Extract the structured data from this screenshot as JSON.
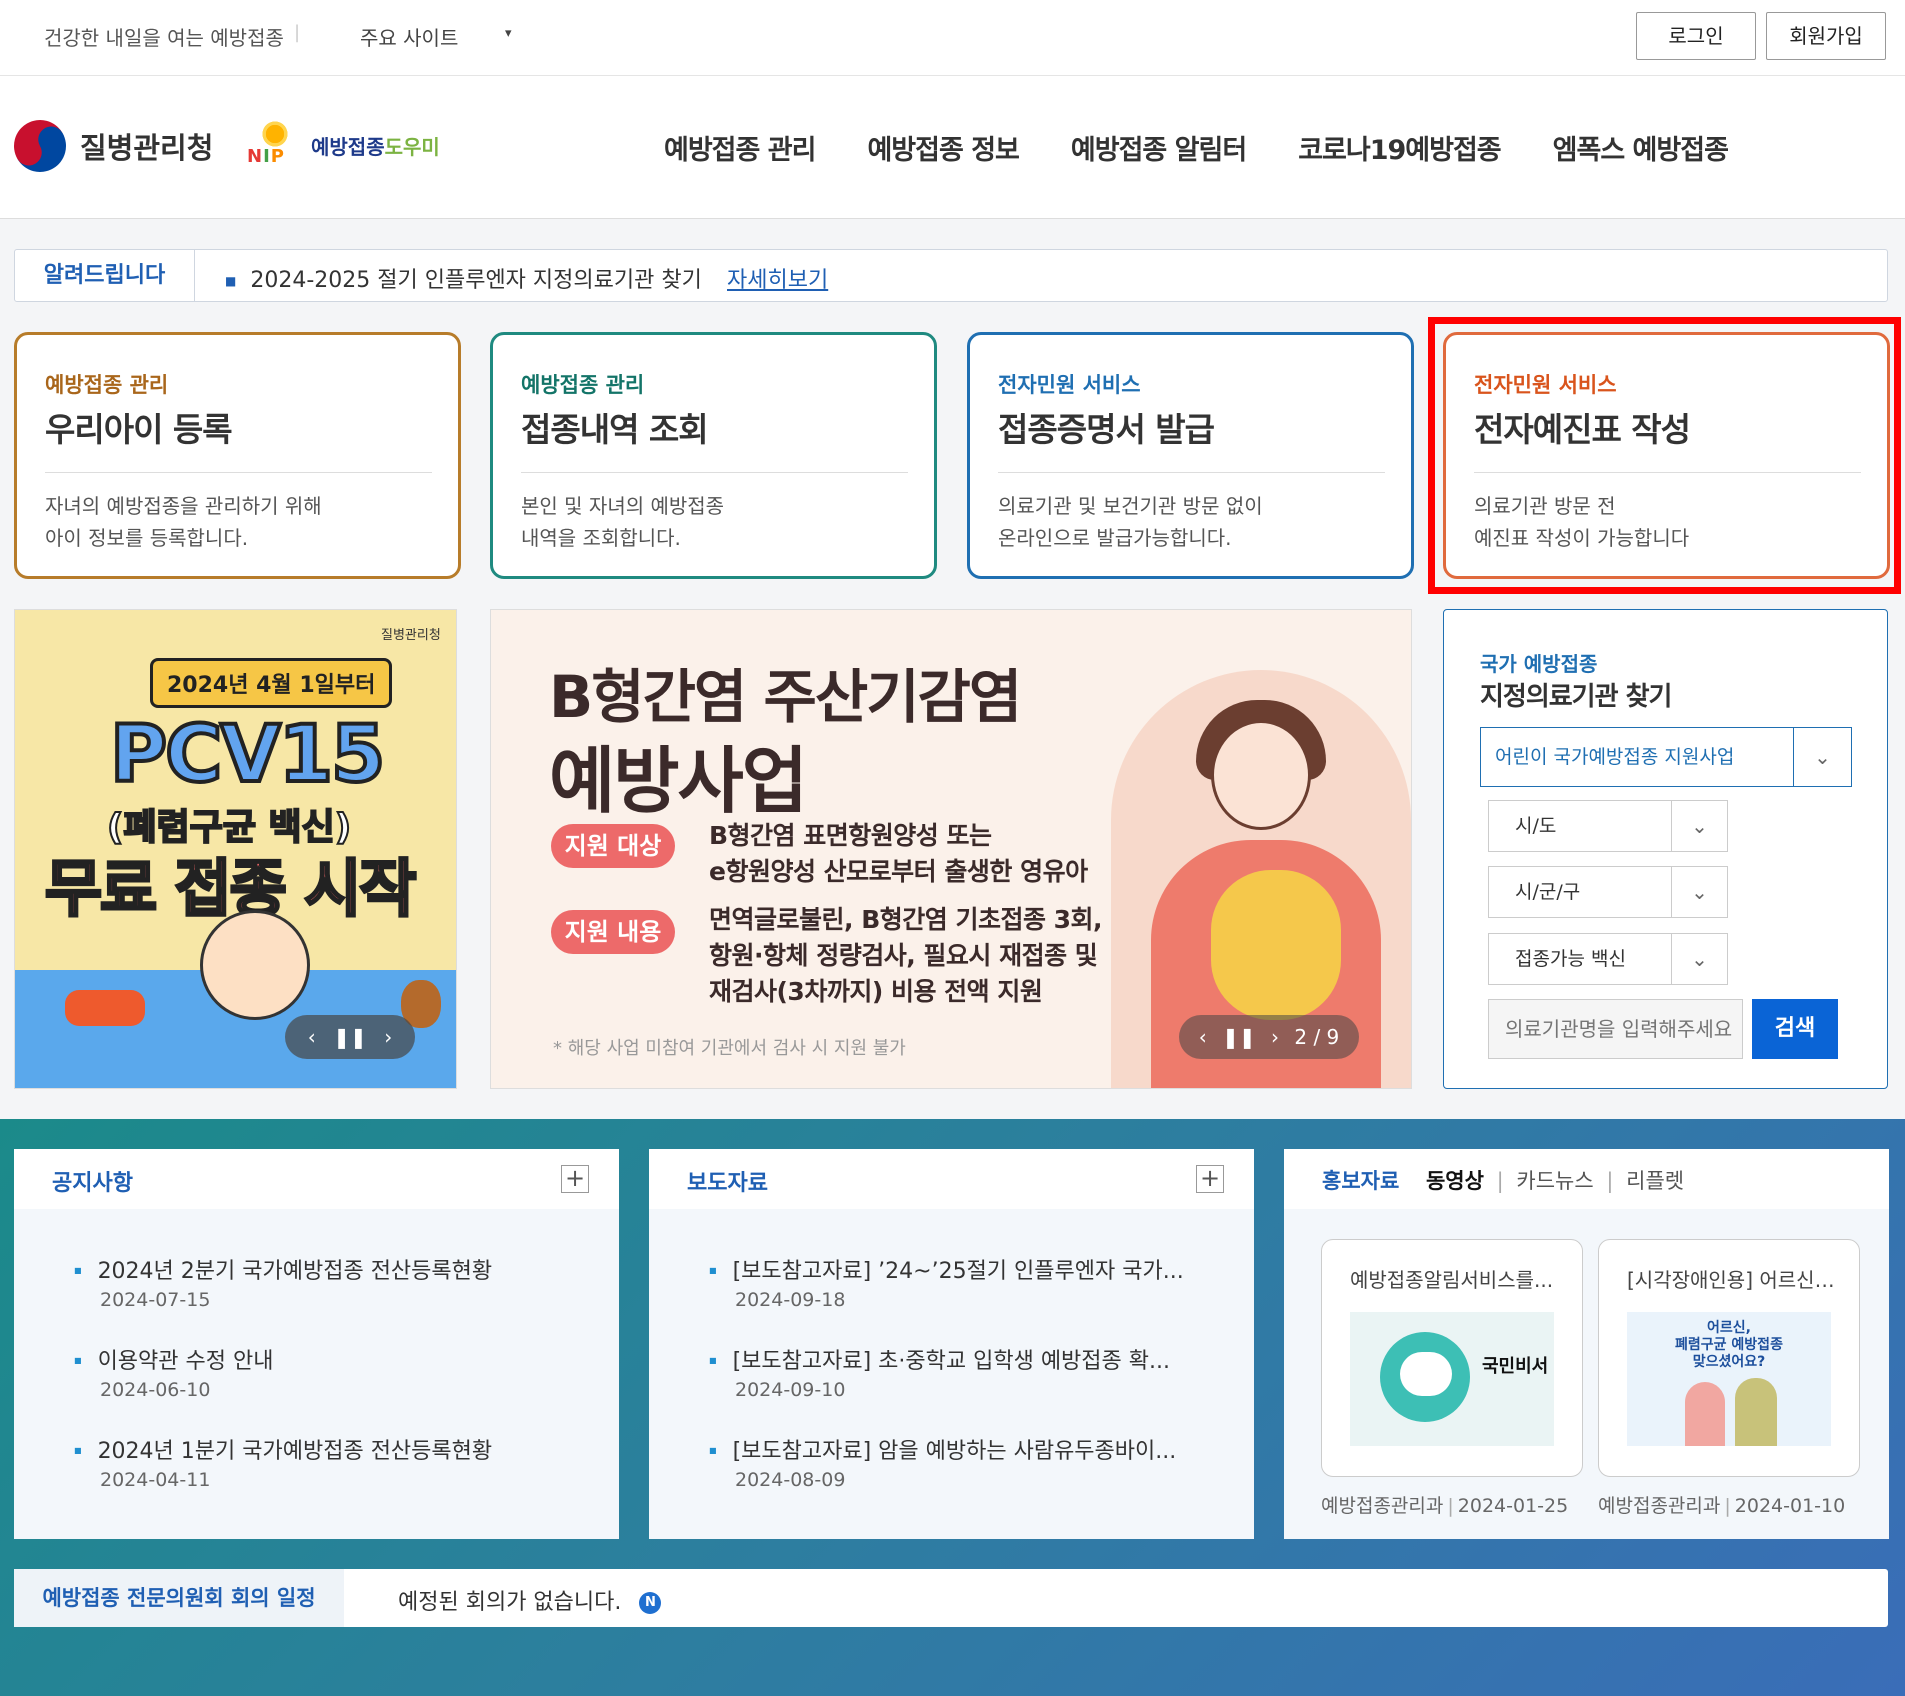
{
  "utility": {
    "slogan": "건강한 내일을 여는 예방접종",
    "separator": "|",
    "sites": "주요 사이트",
    "sites_caret": "▾",
    "login": "로그인",
    "join": "회원가입"
  },
  "header": {
    "agency_name": "질병관리청",
    "nip_letters": [
      "N",
      "I",
      "P"
    ],
    "nip_text_a": "예방접종",
    "nip_text_b": "도우미",
    "nav": [
      "예방접종 관리",
      "예방접종 정보",
      "예방접종 알림터",
      "코로나19예방접종",
      "엠폭스 예방접종"
    ]
  },
  "notice": {
    "label": "알려드립니다",
    "item": "2024-2025 절기 인플루엔자 지정의료기관 찾기",
    "more": "자세히보기"
  },
  "services": [
    {
      "category": "예방접종 관리",
      "title": "우리아이 등록",
      "desc": "자녀의 예방접종을 관리하기 위해\n아이 정보를 등록합니다."
    },
    {
      "category": "예방접종 관리",
      "title": "접종내역 조회",
      "desc": "본인 및 자녀의 예방접종\n내역을 조회합니다."
    },
    {
      "category": "전자민원 서비스",
      "title": "접종증명서 발급",
      "desc": "의료기관 및 보건기관 방문 없이\n온라인으로 발급가능합니다."
    },
    {
      "category": "전자민원 서비스",
      "title": "전자예진표 작성",
      "desc": "의료기관 방문 전\n예진표 작성이 가능합니다"
    }
  ],
  "banner_left": {
    "agency": "질병관리청",
    "date": "2024년 4월 1일부터",
    "headline": "PCV15",
    "sub": "(폐렴구균 백신)",
    "main": "무료 접종 시작",
    "prev": "‹",
    "pause": "❚❚",
    "next": "›"
  },
  "banner_main": {
    "line1": "B형간염 주산기감염",
    "line2": "예방사업",
    "tag1": "지원 대상",
    "desc1": "B형간염 표면항원양성 또는\ne항원양성 산모로부터 출생한 영유아",
    "tag2": "지원 내용",
    "desc2": "면역글로불린, B형간염 기초접종 3회,\n항원·항체 정량검사, 필요시 재접종 및\n재검사(3차까지) 비용 전액 지원",
    "note": "* 해당 사업 미참여 기관에서 검사 시 지원 불가",
    "prev": "‹",
    "pause": "❚❚",
    "next": "›",
    "counter": "2 / 9"
  },
  "finder": {
    "category": "국가 예방접종",
    "title": "지정의료기관 찾기",
    "program": "어린이 국가예방접종 지원사업",
    "sido": "시/도",
    "sigungu": "시/군/구",
    "vaccine": "접종가능 백신",
    "input_placeholder": "의료기관명을 입력해주세요",
    "search": "검색",
    "chevron": "⌄"
  },
  "notices": {
    "title": "공지사항",
    "plus": "+",
    "items": [
      {
        "title": "2024년 2분기 국가예방접종 전산등록현황",
        "date": "2024-07-15"
      },
      {
        "title": "이용약관 수정 안내",
        "date": "2024-06-10"
      },
      {
        "title": "2024년 1분기 국가예방접종 전산등록현황",
        "date": "2024-04-11"
      }
    ]
  },
  "press": {
    "title": "보도자료",
    "plus": "+",
    "items": [
      {
        "title": "[보도참고자료] ’24~’25절기 인플루엔자 국가...",
        "date": "2024-09-18"
      },
      {
        "title": "[보도참고자료] 초·중학교 입학생 예방접종 확...",
        "date": "2024-09-10"
      },
      {
        "title": "[보도참고자료] 암을 예방하는 사람유두종바이...",
        "date": "2024-08-09"
      }
    ]
  },
  "promo": {
    "title": "홍보자료",
    "tabs": [
      "동영상",
      "카드뉴스",
      "리플렛"
    ],
    "tab_sep": "|",
    "items": [
      {
        "title": "예방접종알림서비스를...",
        "thumb_text": "국민비서",
        "dept": "예방접종관리과",
        "date": "2024-01-25"
      },
      {
        "title": "[시각장애인용] 어르신 ...",
        "thumb_text": "어르신,\n폐렴구균 예방접종\n맞으셨어요?",
        "dept": "예방접종관리과",
        "date": "2024-01-10"
      }
    ],
    "meta_sep": "|"
  },
  "committee": {
    "label": "예방접종 전문의원회 회의 일정",
    "message": "예정된 회의가 없습니다.",
    "badge": "N"
  }
}
